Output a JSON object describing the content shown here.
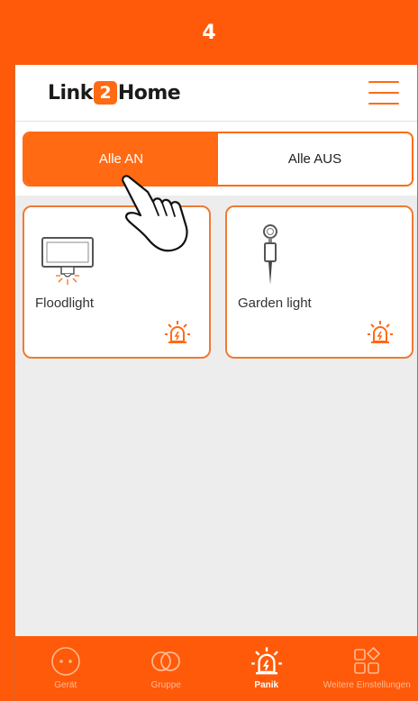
{
  "step": {
    "number": "4"
  },
  "header": {
    "logo": {
      "before": "Link",
      "highlight": "2",
      "after": "Home"
    },
    "menu_icon": "hamburger-icon"
  },
  "panic_toggle": {
    "on_label": "Alle AN",
    "off_label": "Alle AUS",
    "selected": "on"
  },
  "devices": [
    {
      "name": "Floodlight",
      "icon": "floodlight-icon",
      "action_icon": "panic-siren-icon"
    },
    {
      "name": "Garden light",
      "icon": "garden-light-icon",
      "action_icon": "panic-siren-icon"
    }
  ],
  "bottom_nav": [
    {
      "label": "Gerät",
      "icon": "socket-icon",
      "active": false
    },
    {
      "label": "Gruppe",
      "icon": "group-rings-icon",
      "active": false
    },
    {
      "label": "Panik",
      "icon": "panic-siren-icon",
      "active": true
    },
    {
      "label": "Weitere Einstellungen",
      "icon": "more-settings-icon",
      "active": false
    }
  ],
  "colors": {
    "accent": "#ff6a13",
    "banner": "#ff5a0a",
    "background": "#ededed"
  }
}
